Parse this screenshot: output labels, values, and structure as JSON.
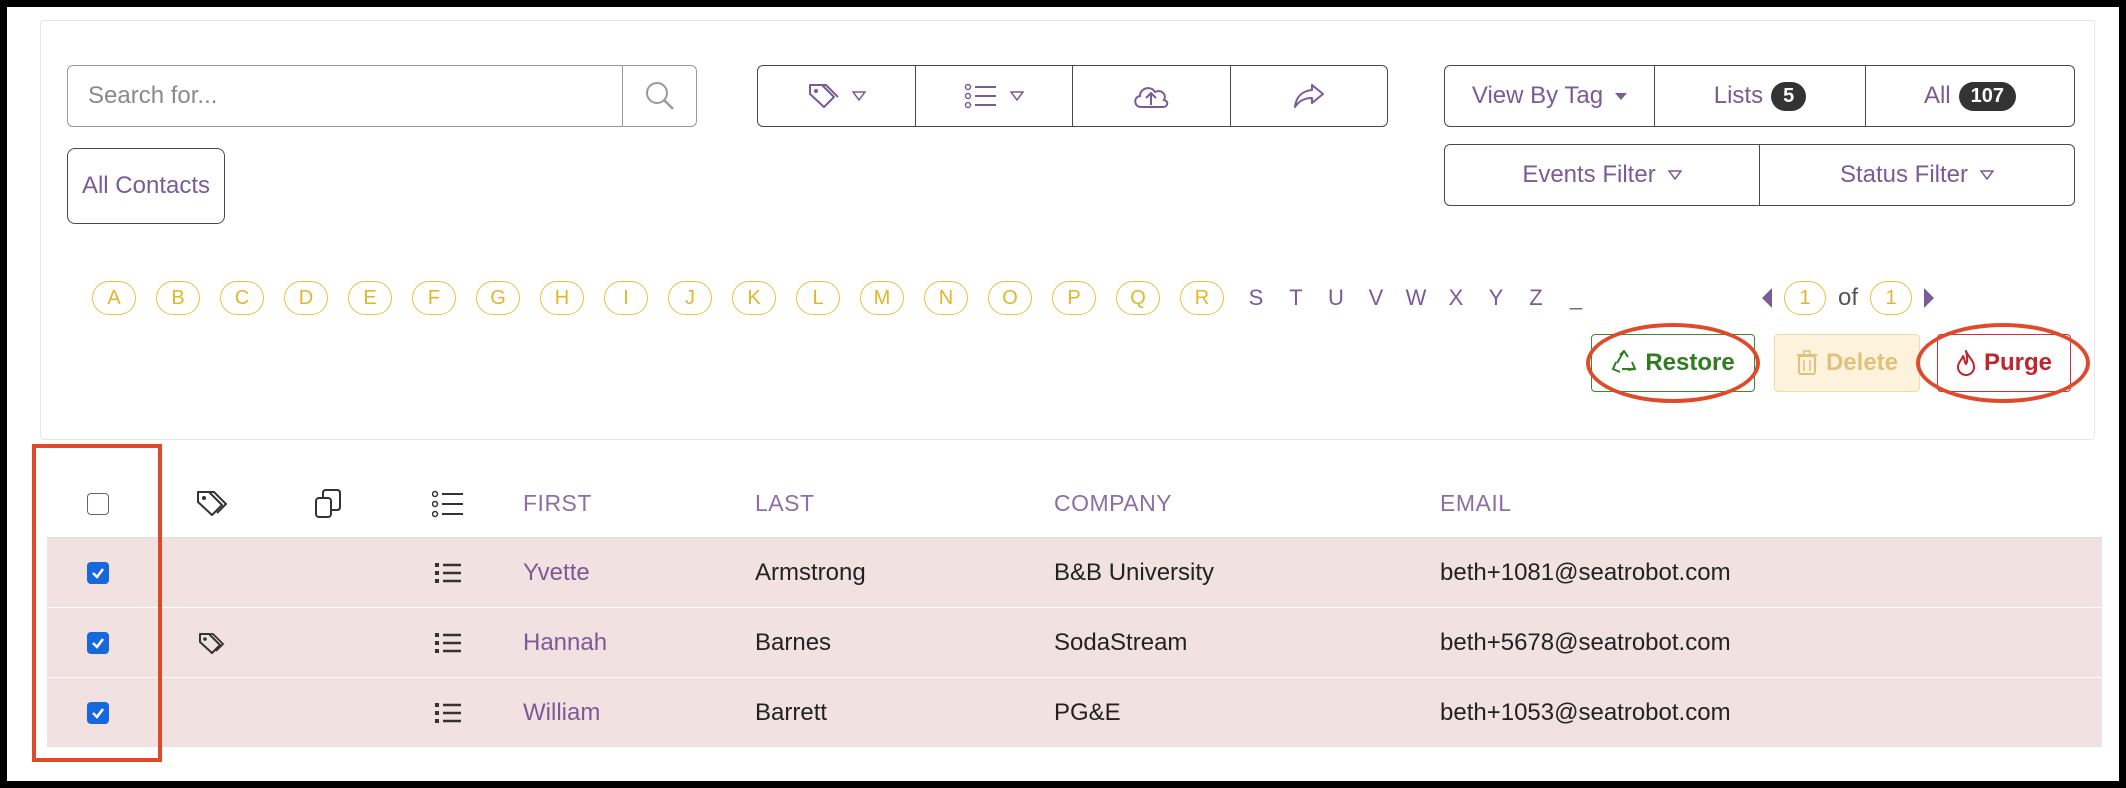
{
  "search": {
    "placeholder": "Search for..."
  },
  "toolbar": {
    "icons": [
      "tag-icon",
      "list-icon",
      "cloud-upload-icon",
      "share-icon"
    ]
  },
  "view_group": {
    "view_by_tag": "View By Tag",
    "lists_label": "Lists",
    "lists_count": "5",
    "all_label": "All",
    "all_count": "107"
  },
  "filters": {
    "events": "Events Filter",
    "status": "Status Filter"
  },
  "all_contacts": "All Contacts",
  "alphabet": {
    "circled": [
      "A",
      "B",
      "C",
      "D",
      "E",
      "F",
      "G",
      "H",
      "I",
      "J",
      "K",
      "L",
      "M",
      "N",
      "O",
      "P",
      "Q",
      "R"
    ],
    "plain": [
      "S",
      "T",
      "U",
      "V",
      "W",
      "X",
      "Y",
      "Z",
      "_"
    ]
  },
  "pager": {
    "current": "1",
    "of": "of",
    "total": "1"
  },
  "actions": {
    "restore": "Restore",
    "delete": "Delete",
    "purge": "Purge"
  },
  "table": {
    "headers": {
      "first": "FIRST",
      "last": "LAST",
      "company": "COMPANY",
      "email": "EMAIL"
    },
    "rows": [
      {
        "checked": true,
        "tagged": false,
        "first": "Yvette",
        "last": "Armstrong",
        "company": "B&B University",
        "email": "beth+1081@seatrobot.com"
      },
      {
        "checked": true,
        "tagged": true,
        "first": "Hannah",
        "last": "Barnes",
        "company": "SodaStream",
        "email": "beth+5678@seatrobot.com"
      },
      {
        "checked": true,
        "tagged": false,
        "first": "William",
        "last": "Barrett",
        "company": "PG&E",
        "email": "beth+1053@seatrobot.com"
      }
    ]
  },
  "colors": {
    "accent": "#7b5a98",
    "restore": "#2f7d1e",
    "purge": "#c0242c",
    "row_bg": "#f1e1e1",
    "highlight": "#e04a2a"
  }
}
